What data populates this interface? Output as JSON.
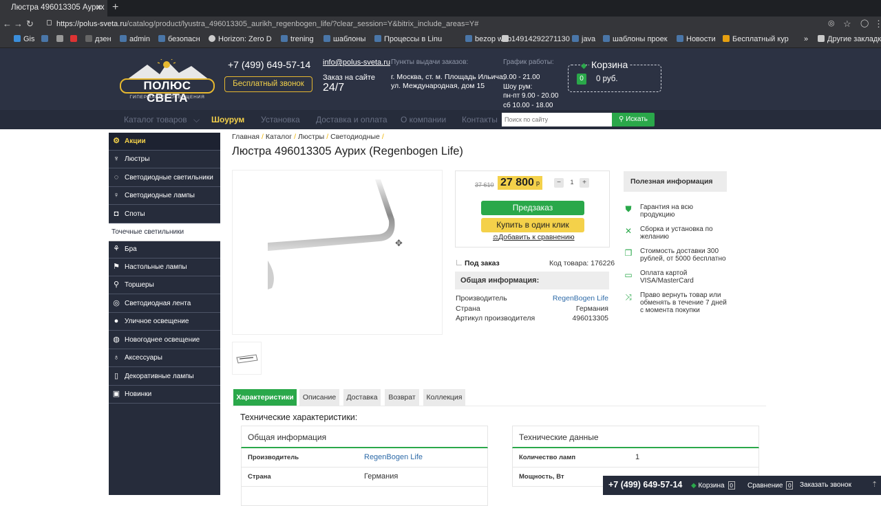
{
  "browser": {
    "tab_title": "Люстра 496013305 Аурих",
    "url_host": "https://polus-sveta.ru",
    "url_path": "/catalog/product/lyustra_496013305_aurikh_regenbogen_life/?clear_session=Y&bitrix_include_areas=Y#",
    "bookmarks": [
      "Gis",
      "admin",
      "безопасн",
      "Horizon: Zero D",
      "trening",
      "шаблоны",
      "Процессы в Linu",
      "bezop web",
      "14914292271130",
      "java",
      "шаблоны проек",
      "Новости",
      "Бесплатный кур"
    ],
    "other_bookmarks": "Другие закладки",
    "bookmark_dzen": "дзен"
  },
  "header": {
    "logo_text": "ПОЛЮС СВЕТА",
    "logo_sub": "ГИПЕРМАРКЕТ ОСВЕЩЕНИЯ",
    "phone": "+7 (499) 649-57-14",
    "callback_label": "Бесплатный звонок",
    "email": "info@polus-sveta.ru",
    "order_label": "Заказ на сайте",
    "order_hours": "24/7",
    "pickup_label": "Пункты выдачи заказов:",
    "pickup_line1": "г. Москва, ст. м. Площадь Ильича,",
    "pickup_line2": "ул. Международная, дом 15",
    "hours_label": "График работы:",
    "hours_line1": "9.00 - 21.00",
    "hours_line2": "Шоу рум:",
    "hours_line3": "пн-пт 9.00 - 20.00",
    "hours_line4": "сб 10.00 - 18.00",
    "cart_title": "Корзина",
    "cart_count": "0",
    "cart_sum": "0 руб."
  },
  "nav": {
    "catalog": "Каталог товаров",
    "showroom": "Шоурум",
    "install": "Установка",
    "delivery": "Доставка и оплата",
    "about": "О компании",
    "contacts": "Контакты",
    "search_placeholder": "Поиск по сайту",
    "search_button": "Искать"
  },
  "sidebar": {
    "items": [
      {
        "label": "Акции",
        "icon": "⚙"
      },
      {
        "label": "Люстры",
        "icon": "♆"
      },
      {
        "label": "Светодиодные светильники",
        "icon": "◌"
      },
      {
        "label": "Светодиодные лампы",
        "icon": "♀"
      },
      {
        "label": "Споты",
        "icon": "◘"
      },
      {
        "label": "Точечные светильники",
        "icon": ""
      },
      {
        "label": "Бра",
        "icon": "⚘"
      },
      {
        "label": "Настольные лампы",
        "icon": "⚑"
      },
      {
        "label": "Торшеры",
        "icon": "⚲"
      },
      {
        "label": "Светодиодная лента",
        "icon": "◎"
      },
      {
        "label": "Уличное освещение",
        "icon": "●"
      },
      {
        "label": "Новогоднее освещение",
        "icon": "◍"
      },
      {
        "label": "Аксессуары",
        "icon": "♁"
      },
      {
        "label": "Декоративные лампы",
        "icon": "▯"
      },
      {
        "label": "Новинки",
        "icon": "▣"
      }
    ]
  },
  "breadcrumbs": [
    "Главная",
    "Каталог",
    "Люстры",
    "Светодиодные"
  ],
  "product": {
    "title": "Люстра 496013305 Аурих (Regenbogen Life)",
    "old_price": "37 610",
    "price": "27 800",
    "currency": "р",
    "qty": "1",
    "qty_minus": "−",
    "qty_plus": "+",
    "preorder_label": "Предзаказ",
    "oneclick_label": "Купить в один клик",
    "compare_label": "Добавить к сравнению",
    "availability": "Под заказ",
    "code_label": "Код товара: 176226",
    "general_info_head": "Общая информация:",
    "specs": [
      {
        "k": "Производитель",
        "v": "RegenBogen Life"
      },
      {
        "k": "Страна",
        "v": "Германия"
      },
      {
        "k": "Артикул производителя",
        "v": "496013305"
      }
    ]
  },
  "useful": {
    "title": "Полезная информация",
    "items": [
      "Гарантия на всю продукцию",
      "Сборка и установка по желанию",
      "Стоимость доставки 300 рублей, от 5000 бесплатно",
      "Оплата картой VISA/MasterCard",
      "Право вернуть товар или обменять в течение 7 дней с момента покупки"
    ]
  },
  "tabs": [
    "Характеристики",
    "Описание",
    "Доставка",
    "Возврат",
    "Коллекция"
  ],
  "tech": {
    "title": "Технические характеристики:",
    "general_head": "Общая информация",
    "general_rows": [
      {
        "k": "Производитель",
        "v": "RegenBogen Life"
      },
      {
        "k": "Страна",
        "v": "Германия"
      }
    ],
    "data_head": "Технические данные",
    "data_rows": [
      {
        "k": "Количество ламп",
        "v": "1"
      },
      {
        "k": "Мощность, Вт",
        "v": ""
      }
    ]
  },
  "bottom_bar": {
    "phone": "+7 (499) 649-57-14",
    "cart_label": "Корзина",
    "cart_count": "0",
    "compare_label": "Сравнение",
    "compare_count": "0",
    "call_label": "Заказать звонок"
  },
  "colors": {
    "header_bg": "#2c3243",
    "accent_green": "#2aa84a",
    "accent_yellow": "#f4d14a",
    "link_blue": "#2d6aa8"
  }
}
